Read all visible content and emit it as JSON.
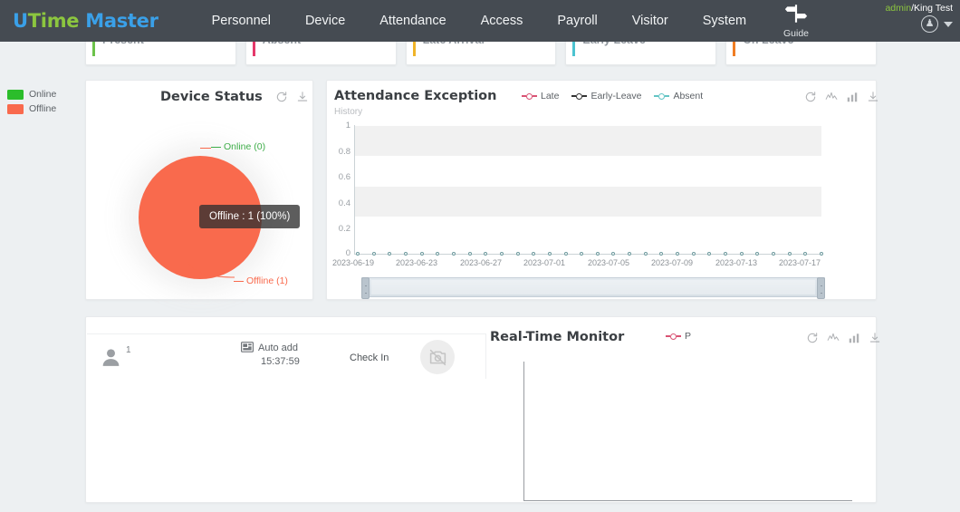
{
  "topbar": {
    "logo": {
      "part1": "U",
      "part2": "Time",
      "part3": " Master"
    },
    "nav": [
      {
        "label": "Personnel"
      },
      {
        "label": "Device"
      },
      {
        "label": "Attendance"
      },
      {
        "label": "Access"
      },
      {
        "label": "Payroll"
      },
      {
        "label": "Visitor"
      },
      {
        "label": "System"
      }
    ],
    "guide_label": "Guide",
    "user": {
      "role": "admin",
      "name": "/King Test"
    }
  },
  "stats": [
    {
      "label": "Present",
      "color": "#6cc24a"
    },
    {
      "label": "Absent",
      "color": "#e5396b"
    },
    {
      "label": "Late Arrival",
      "color": "#f0b429"
    },
    {
      "label": "Early Leave",
      "color": "#4cc3d0"
    },
    {
      "label": "On Leave",
      "color": "#f07d23"
    }
  ],
  "device_status": {
    "title": "Device Status",
    "legend": [
      {
        "label": "Online",
        "color": "#2bbd2b"
      },
      {
        "label": "Offline",
        "color": "#f96a4d"
      }
    ],
    "label_online": "Online (0)",
    "label_offline": "Offline (1)",
    "tooltip": "Offline : 1 (100%)",
    "tools": [
      "refresh-icon",
      "download-icon"
    ],
    "chart_data": {
      "type": "pie",
      "title": "Device Status",
      "categories": [
        "Online",
        "Offline"
      ],
      "values": [
        0,
        1
      ],
      "colors": [
        "#2bbd2b",
        "#f96a4d"
      ],
      "legend_position": "top-left"
    }
  },
  "attendance_exception": {
    "title": "Attendance Exception",
    "subtitle": "History",
    "legend": [
      {
        "label": "Late",
        "color": "#d95374"
      },
      {
        "label": "Early-Leave",
        "color": "#333333"
      },
      {
        "label": "Absent",
        "color": "#63c5c5"
      }
    ],
    "tools": [
      "refresh-icon",
      "line-chart-icon",
      "bar-chart-icon",
      "download-icon"
    ],
    "chart_data": {
      "type": "line",
      "title": "Attendance Exception",
      "subtitle": "History",
      "xlabel": "",
      "ylabel": "",
      "ylim": [
        0,
        1
      ],
      "yticks": [
        "0",
        "0.2",
        "0.4",
        "0.6",
        "0.8",
        "1"
      ],
      "grid": true,
      "legend_position": "top-center",
      "xticks": [
        "2023-06-19",
        "2023-06-23",
        "2023-06-27",
        "2023-07-01",
        "2023-07-05",
        "2023-07-09",
        "2023-07-13",
        "2023-07-17"
      ],
      "series": [
        {
          "name": "Late",
          "color": "#d95374",
          "values": [
            0,
            0,
            0,
            0,
            0,
            0,
            0,
            0,
            0,
            0,
            0,
            0,
            0,
            0,
            0,
            0,
            0,
            0,
            0,
            0,
            0,
            0,
            0,
            0,
            0,
            0,
            0,
            0,
            0,
            0
          ]
        },
        {
          "name": "Early-Leave",
          "color": "#333333",
          "values": [
            0,
            0,
            0,
            0,
            0,
            0,
            0,
            0,
            0,
            0,
            0,
            0,
            0,
            0,
            0,
            0,
            0,
            0,
            0,
            0,
            0,
            0,
            0,
            0,
            0,
            0,
            0,
            0,
            0,
            0
          ]
        },
        {
          "name": "Absent",
          "color": "#63c5c5",
          "values": [
            0,
            0,
            0,
            0,
            0,
            0,
            0,
            0,
            0,
            0,
            0,
            0,
            0,
            0,
            0,
            0,
            0,
            0,
            0,
            0,
            0,
            0,
            0,
            0,
            0,
            0,
            0,
            0,
            0,
            0
          ]
        }
      ]
    }
  },
  "realtime": {
    "title": "Real-Time Monitor",
    "legend": [
      {
        "label": "P",
        "color": "#d95374"
      }
    ],
    "tools": [
      "refresh-icon",
      "line-chart-icon",
      "bar-chart-icon",
      "download-icon"
    ],
    "punch": {
      "person_count": "1",
      "source_label": "Auto add",
      "time": "15:37:59",
      "state": "Check In"
    },
    "chart_data": {
      "type": "line",
      "title": "Real-Time Monitor",
      "series": [
        {
          "name": "P",
          "color": "#d95374",
          "values": []
        }
      ],
      "categories": [],
      "grid": false,
      "legend_position": "top-center"
    }
  }
}
